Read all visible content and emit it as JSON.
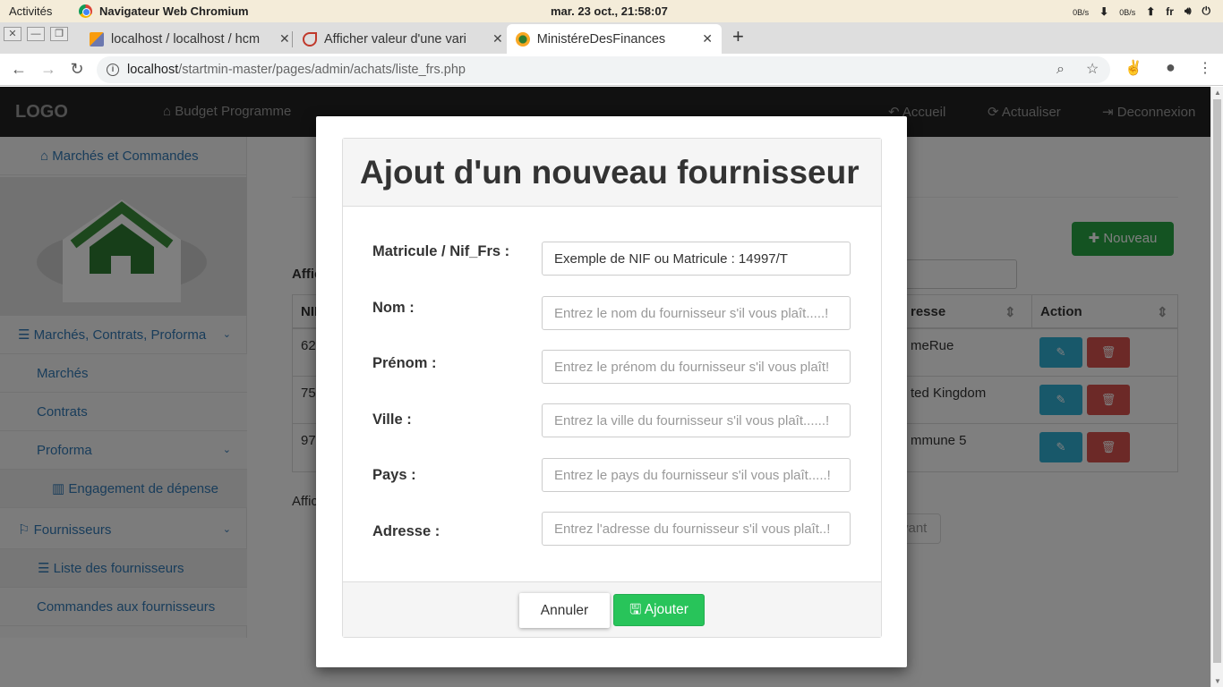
{
  "gnome": {
    "activities": "Activités",
    "app_name": "Navigateur Web Chromium",
    "clock": "mar. 23 oct., 21:58:07",
    "net_down": "0B/s",
    "net_up": "0B/s",
    "lang": "fr"
  },
  "tabs": [
    {
      "title": "localhost / localhost / hcm",
      "favicon": "phpmyadmin-icon"
    },
    {
      "title": "Afficher valeur d'une vari",
      "favicon": "site-icon"
    },
    {
      "title": "MinistéreDesFinances",
      "favicon": "site-icon"
    }
  ],
  "address": {
    "host": "localhost",
    "path": "/startmin-master/pages/admin/achats/liste_frs.php"
  },
  "topnav": {
    "logo": "LOGO",
    "brand": "Budget Programme",
    "accueil": "Accueil",
    "actualiser": "Actualiser",
    "deconnexion": "Deconnexion"
  },
  "sidebar": {
    "home": "Marchés et Commandes",
    "group1": "Marchés, Contrats, Proforma",
    "marches": "Marchés",
    "contrats": "Contrats",
    "proforma": "Proforma",
    "engagement": "Engagement de dépense",
    "fournisseurs": "Fournisseurs",
    "liste": "Liste des fournisseurs",
    "commandes": "Commandes aux fournisseurs"
  },
  "content": {
    "nouveau": "Nouveau",
    "afficher_top": "Affic",
    "afficher_bottom": "Affic",
    "suivant": "vant",
    "columns": {
      "nif": "NIF",
      "adresse": "resse",
      "action": "Action"
    },
    "rows": [
      {
        "nif": "62",
        "adresse": "meRue"
      },
      {
        "nif": "75",
        "adresse": "ted Kingdom"
      },
      {
        "nif": "97",
        "adresse": "mmune 5"
      }
    ]
  },
  "modal": {
    "title": "Ajout d'un nouveau fournisseur",
    "fields": {
      "matricule": {
        "label": "Matricule / Nif_Frs :",
        "value": "Exemple de NIF ou Matricule : 14997/T"
      },
      "nom": {
        "label": "Nom :",
        "placeholder": "Entrez le nom du fournisseur s'il vous plaît.....!"
      },
      "prenom": {
        "label": "Prénom :",
        "placeholder": "Entrez le prénom du fournisseur s'il vous plaît!"
      },
      "ville": {
        "label": "Ville :",
        "placeholder": "Entrez la ville du fournisseur s'il vous plaît......!"
      },
      "pays": {
        "label": "Pays :",
        "placeholder": "Entrez le pays du fournisseur s'il vous plaît.....!"
      },
      "adresse": {
        "label": "Adresse :",
        "placeholder": "Entrez l'adresse du fournisseur s'il vous plaît..!"
      }
    },
    "cancel": "Annuler",
    "submit": "Ajouter"
  },
  "colors": {
    "navbar": "#222222",
    "success": "#28a745",
    "info": "#31b0d5",
    "danger": "#d9534f",
    "link": "#337ab7"
  }
}
